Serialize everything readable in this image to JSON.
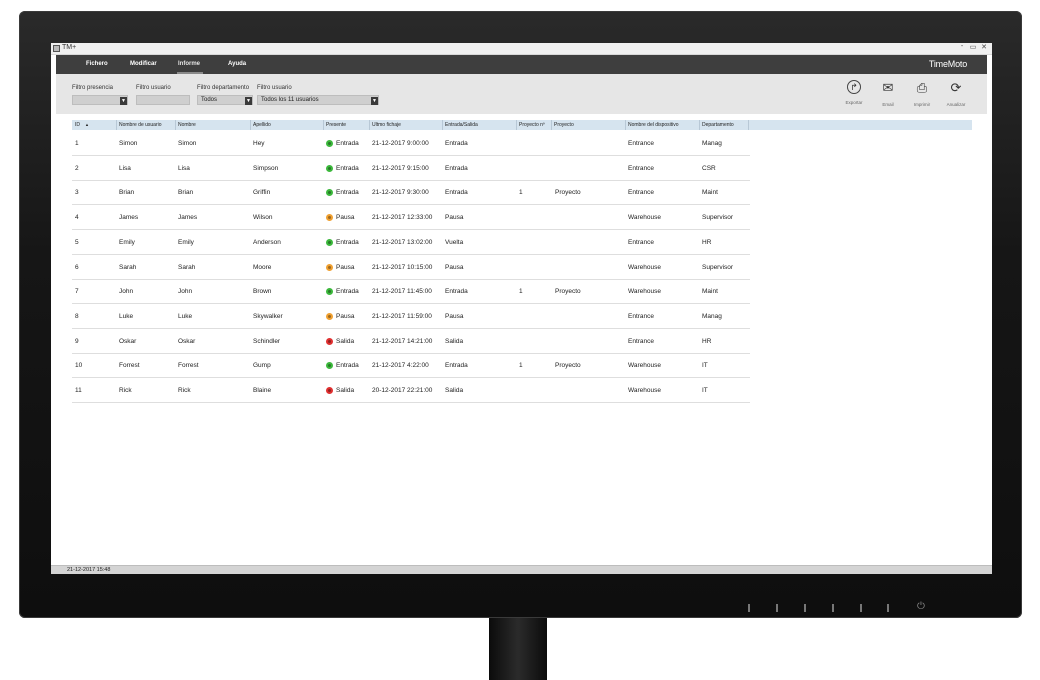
{
  "window": {
    "title": "TM+",
    "controls": {
      "minimize": "-",
      "maximize": "▭",
      "close": "✕"
    }
  },
  "menu": {
    "items": [
      "Fichero",
      "Modificar",
      "Informe",
      "Ayuda"
    ],
    "active": "Informe",
    "logo": "TimeMoto"
  },
  "filters": {
    "presence": {
      "label": "Filtro presencia",
      "value": ""
    },
    "user": {
      "label": "Filtro usuario",
      "value": ""
    },
    "department": {
      "label": "Filtro departamento",
      "value": "Todos"
    },
    "user_select": {
      "label": "Filtro usuario",
      "value": "Todos los 11 usuarios"
    }
  },
  "toolbar": {
    "export": {
      "label": "Exportar",
      "icon": "export-icon"
    },
    "email": {
      "label": "Email",
      "icon": "envelope-icon"
    },
    "print": {
      "label": "Imprimir",
      "icon": "printer-icon"
    },
    "refresh": {
      "label": "Anualizar",
      "icon": "refresh-icon"
    }
  },
  "table": {
    "columns": [
      "ID",
      "Nombre de usuario",
      "Nombre",
      "Apellido",
      "Presente",
      "Ultmo fichaje",
      "Entrada/Salida",
      "Proyecto nº",
      "Proyecto",
      "Nombre del dispositivo",
      "Departamento"
    ],
    "sort_indicator": "▲",
    "status_colors": {
      "Entrada": "#3cb83c",
      "Pausa": "#f0a030",
      "Salida": "#e03030"
    },
    "rows": [
      [
        "1",
        "Simon",
        "Simon",
        "Hey",
        "Entrada",
        "21-12-2017 9:00:00",
        "Entrada",
        "",
        "",
        "Entrance",
        "Manag"
      ],
      [
        "2",
        "Lisa",
        "Lisa",
        "Simpson",
        "Entrada",
        "21-12-2017 9:15:00",
        "Entrada",
        "",
        "",
        "Entrance",
        "CSR"
      ],
      [
        "3",
        "Brian",
        "Brian",
        "Griffin",
        "Entrada",
        "21-12-2017 9:30:00",
        "Entrada",
        "1",
        "Proyecto",
        "Entrance",
        "Maint"
      ],
      [
        "4",
        "James",
        "James",
        "Wilson",
        "Pausa",
        "21-12-2017 12:33:00",
        "Pausa",
        "",
        "",
        "Warehouse",
        "Supervisor"
      ],
      [
        "5",
        "Emily",
        "Emily",
        "Anderson",
        "Entrada",
        "21-12-2017 13:02:00",
        "Vuelta",
        "",
        "",
        "Entrance",
        "HR"
      ],
      [
        "6",
        "Sarah",
        "Sarah",
        "Moore",
        "Pausa",
        "21-12-2017 10:15:00",
        "Pausa",
        "",
        "",
        "Warehouse",
        "Supervisor"
      ],
      [
        "7",
        "John",
        "John",
        "Brown",
        "Entrada",
        "21-12-2017 11:45:00",
        "Entrada",
        "1",
        "Proyecto",
        "Warehouse",
        "Maint"
      ],
      [
        "8",
        "Luke",
        "Luke",
        "Skywalker",
        "Pausa",
        "21-12-2017 11:59:00",
        "Pausa",
        "",
        "",
        "Entrance",
        "Manag"
      ],
      [
        "9",
        "Oskar",
        "Oskar",
        "Schindler",
        "Salida",
        "21-12-2017 14:21:00",
        "Salida",
        "",
        "",
        "Entrance",
        "HR"
      ],
      [
        "10",
        "Forrest",
        "Forrest",
        "Gump",
        "Entrada",
        "21-12-2017 4:22:00",
        "Entrada",
        "1",
        "Proyecto",
        "Warehouse",
        "IT"
      ],
      [
        "11",
        "Rick",
        "Rick",
        "Blaine",
        "Salida",
        "20-12-2017 22:21:00",
        "Salida",
        "",
        "",
        "Warehouse",
        "IT"
      ]
    ]
  },
  "statusbar": {
    "text": "21-12-2017 15:48"
  }
}
